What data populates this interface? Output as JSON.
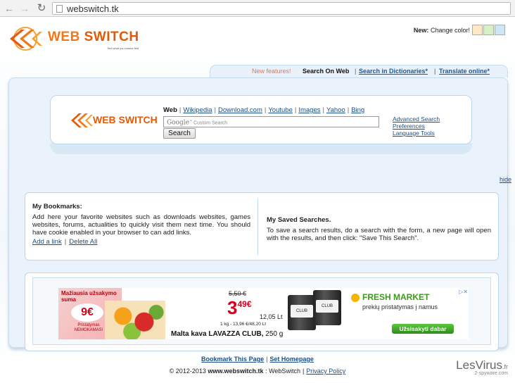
{
  "browser": {
    "url": "webswitch.tk"
  },
  "header": {
    "logo_text_a": "WEB ",
    "logo_text_b": "SWITCH",
    "logo_tagline": "find what you wanna find",
    "color_new": "New:",
    "color_label": "Change color!",
    "swatch_colors": [
      "#fde8c8",
      "#d8efc8",
      "#cfe6f6"
    ]
  },
  "tabs": {
    "new_features": "New features!",
    "search_web": "Search On Web",
    "sep1": "|",
    "search_dict": "Search in Dictionaries*",
    "sep2": "|",
    "translate": "Translate online*"
  },
  "search": {
    "logo_text": "WEB SWITCH",
    "engines": [
      {
        "label": "Web",
        "active": true
      },
      {
        "label": "Wikipedia",
        "active": false
      },
      {
        "label": "Download.com",
        "active": false
      },
      {
        "label": "Youtube",
        "active": false
      },
      {
        "label": "Images",
        "active": false
      },
      {
        "label": "Yahoo",
        "active": false
      },
      {
        "label": "Bing",
        "active": false
      }
    ],
    "engine_sep": "|",
    "input_brand": "Google",
    "input_placeholder": "Custom Search",
    "button_label": "Search",
    "links": [
      "Advanced Search",
      "Preferences",
      "Language Tools"
    ]
  },
  "hide_label": "hide",
  "bookmarks": {
    "title": "My Bookmarks:",
    "text": "Add here your favorite websites such as downloads websites, games websites, forums, actualities to quickly visit them next time. You should have cookie enabled in your browser to can add links.",
    "add_link": "Add a link",
    "sep": "|",
    "delete_all": "Delete All"
  },
  "saved": {
    "title": "My Saved Searches.",
    "text": "To save a search results, do a search with the form, a new page will open with the results, and then click: \"Save This Search\"."
  },
  "ad": {
    "left_title": "Mažiausia užsakymo suma",
    "left_price": "9€",
    "left_note": "Pristatymas NEMOKAMAS!",
    "old_price": "5,50 €",
    "price_main": "3",
    "price_cents": "49€",
    "price_lt": "12,05 Lt",
    "unit_price": "1 kg - 13,96 €/48,20 Lt",
    "product_name": "Malta kava LAVAZZA CLUB,",
    "product_weight": " 250 g",
    "can_label": "CLUB",
    "brand": "FRESH MARKET",
    "brand_sub": "prekių pristatymas į namus",
    "cta": "Užsisakyti dabar",
    "close": "▷✕"
  },
  "footer": {
    "bookmark": "Bookmark This Page",
    "sep": "|",
    "homepage": "Set Homepage",
    "copy_prefix": "© 2012-2013",
    "copy_site": "www.webswitch.tk",
    "copy_sep1": ":",
    "copy_name": "WebSwitch",
    "copy_sep2": "|",
    "privacy": "Privacy Policy"
  },
  "watermark": {
    "main": "LesVirus",
    "suffix": ".fr",
    "sub": "2-spyware.com"
  }
}
